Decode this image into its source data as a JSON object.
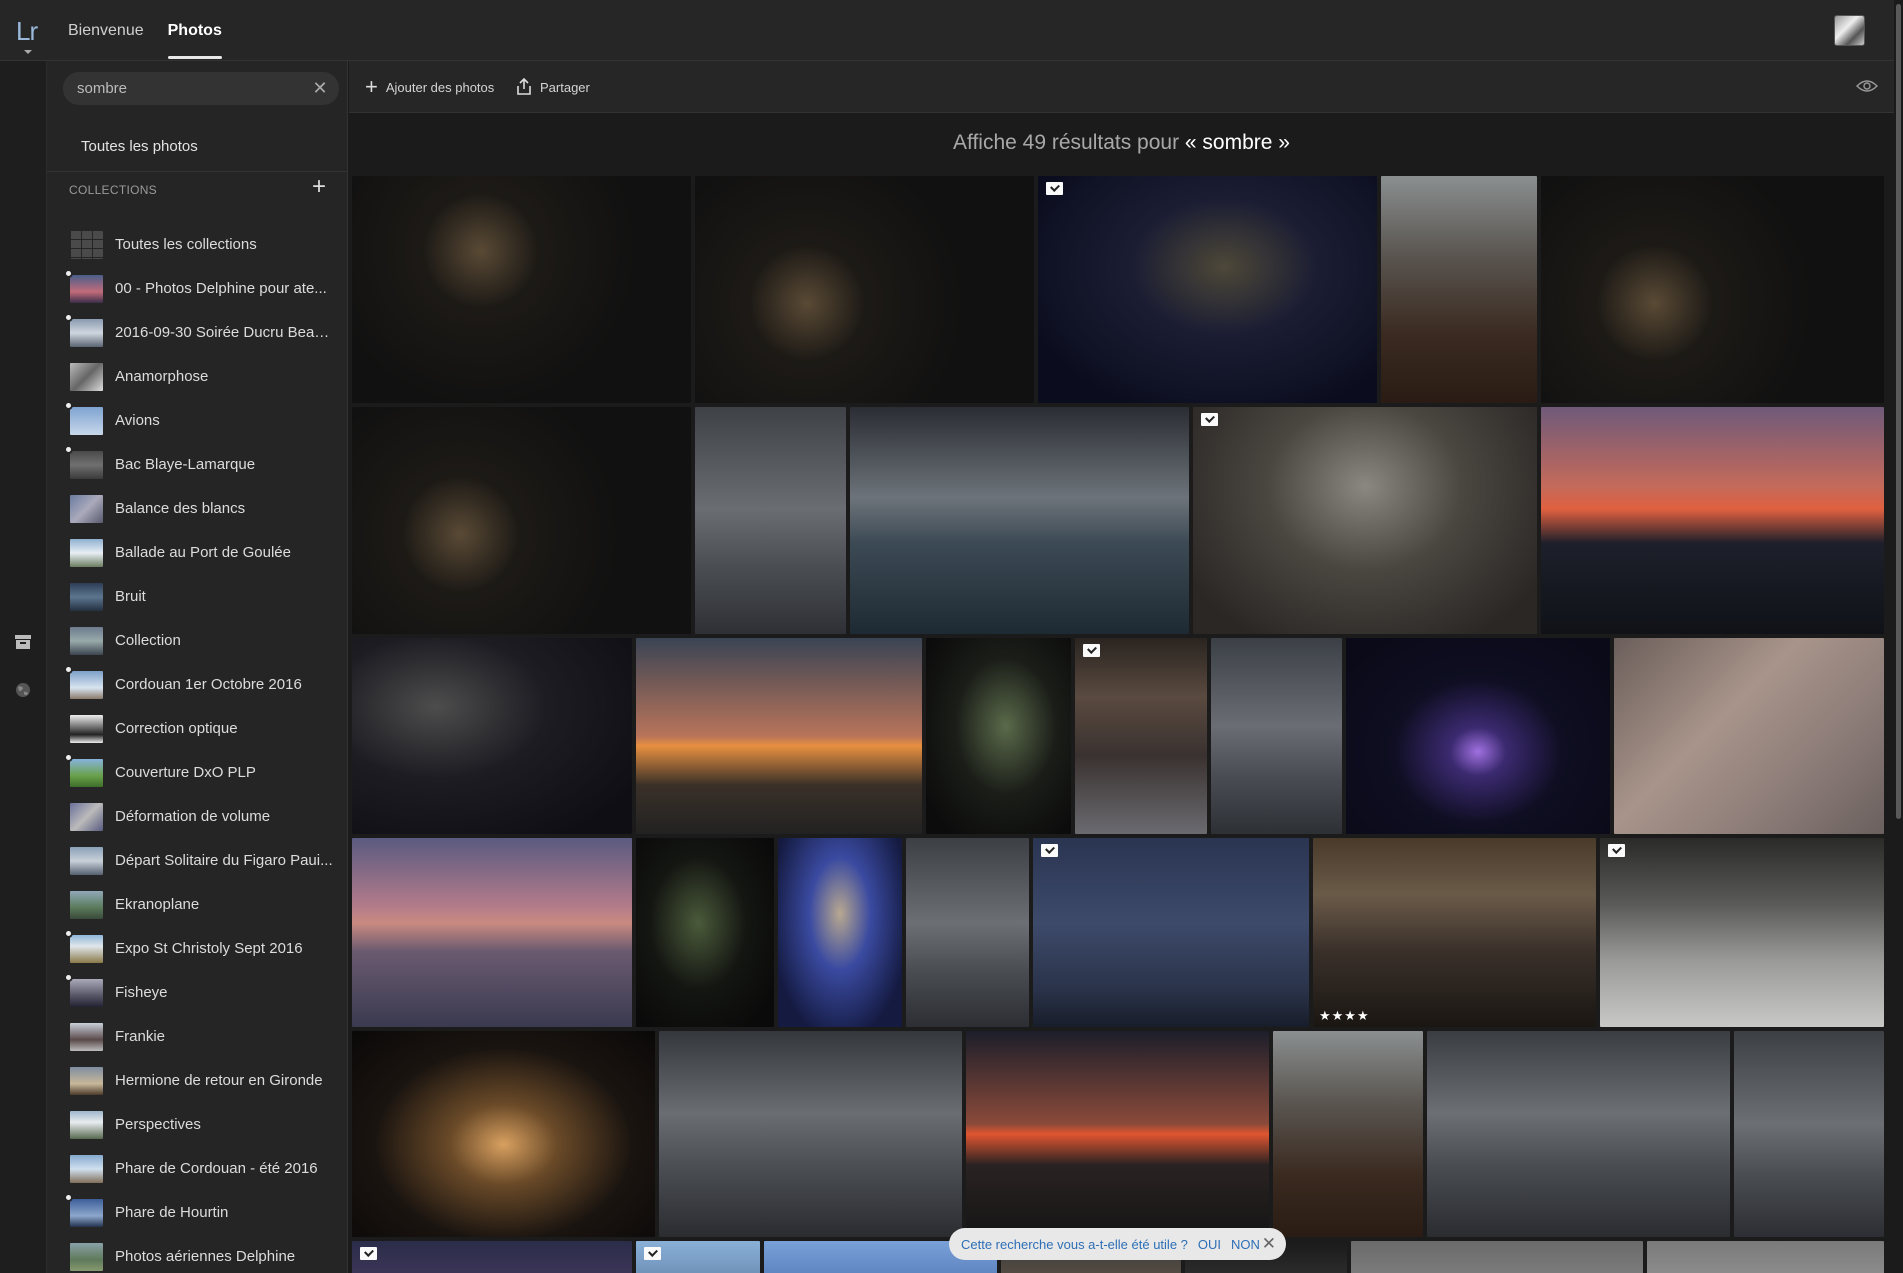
{
  "app": {
    "logo": "Lr",
    "nav": [
      {
        "label": "Bienvenue"
      },
      {
        "label": "Photos",
        "active": true
      }
    ]
  },
  "sidebar": {
    "search": {
      "value": "sombre"
    },
    "all_photos_label": "Toutes les photos",
    "collections_header": "COLLECTIONS",
    "collections": [
      {
        "label": "Toutes les collections",
        "shared": false
      },
      {
        "label": "00 - Photos Delphine pour ate...",
        "shared": true
      },
      {
        "label": "2016-09-30 Soirée Ducru Beau...",
        "shared": true
      },
      {
        "label": "Anamorphose",
        "shared": false
      },
      {
        "label": "Avions",
        "shared": true
      },
      {
        "label": "Bac Blaye-Lamarque",
        "shared": true
      },
      {
        "label": "Balance des blancs",
        "shared": false
      },
      {
        "label": "Ballade au Port de Goulée",
        "shared": false
      },
      {
        "label": "Bruit",
        "shared": false
      },
      {
        "label": "Collection",
        "shared": false
      },
      {
        "label": "Cordouan 1er Octobre 2016",
        "shared": true
      },
      {
        "label": "Correction optique",
        "shared": false
      },
      {
        "label": "Couverture DxO PLP",
        "shared": true
      },
      {
        "label": "Déformation de volume",
        "shared": false
      },
      {
        "label": "Départ Solitaire du Figaro Paui...",
        "shared": false
      },
      {
        "label": "Ekranoplane",
        "shared": false
      },
      {
        "label": "Expo St Christoly Sept 2016",
        "shared": true
      },
      {
        "label": "Fisheye",
        "shared": true
      },
      {
        "label": "Frankie",
        "shared": false
      },
      {
        "label": "Hermione de retour en Gironde",
        "shared": false
      },
      {
        "label": "Perspectives",
        "shared": false
      },
      {
        "label": "Phare de Cordouan - été 2016",
        "shared": false
      },
      {
        "label": "Phare de Hourtin",
        "shared": true
      },
      {
        "label": "Photos aériennes Delphine",
        "shared": false
      }
    ]
  },
  "toolbar": {
    "add_label": "Ajouter des photos",
    "share_label": "Partager"
  },
  "results": {
    "prefix": "Affiche 49 résultats pour",
    "query": "« sombre »"
  },
  "grid": {
    "tiles": [
      {
        "name": "photo-dark-room-1",
        "flag": false
      },
      {
        "name": "photo-dark-room-2",
        "flag": false
      },
      {
        "name": "photo-candles-dinner",
        "flag": true
      },
      {
        "name": "photo-lighthouse-stairs",
        "flag": false
      },
      {
        "name": "photo-dark-room-3",
        "flag": false
      },
      {
        "name": "photo-dark-room-4",
        "flag": false
      },
      {
        "name": "photo-cloudy-sky-1",
        "flag": false
      },
      {
        "name": "photo-stormy-sea",
        "flag": false
      },
      {
        "name": "photo-round-window",
        "flag": true
      },
      {
        "name": "photo-city-sunset",
        "flag": false
      },
      {
        "name": "photo-ekranoplane",
        "flag": false
      },
      {
        "name": "photo-lighthouse-lamp",
        "flag": false
      },
      {
        "name": "photo-night-garden-1",
        "flag": false
      },
      {
        "name": "photo-chapel-window",
        "flag": true
      },
      {
        "name": "photo-cloudy-sky-2",
        "flag": false
      },
      {
        "name": "photo-castle-purple",
        "flag": false
      },
      {
        "name": "photo-pool-palm",
        "flag": false
      },
      {
        "name": "photo-pink-sunset",
        "flag": false
      },
      {
        "name": "photo-night-garden-2",
        "flag": false
      },
      {
        "name": "photo-guitarist",
        "flag": false
      },
      {
        "name": "photo-cloudy-sky-3",
        "flag": false
      },
      {
        "name": "photo-lighthouse-dusk",
        "flag": true
      },
      {
        "name": "photo-hall-windows",
        "flag": false,
        "stars": "★★★★"
      },
      {
        "name": "photo-table-candles",
        "flag": true
      },
      {
        "name": "photo-birthday-child",
        "flag": false
      },
      {
        "name": "photo-cloudy-sky-4",
        "flag": false
      },
      {
        "name": "photo-silhouettes-sunset",
        "flag": false
      },
      {
        "name": "photo-lighthouse-stairs-2",
        "flag": false
      },
      {
        "name": "photo-cloudy-sky-5",
        "flag": false
      },
      {
        "name": "photo-cloudy-sky-6",
        "flag": false
      },
      {
        "name": "photo-row6-1",
        "flag": true
      },
      {
        "name": "photo-row6-2",
        "flag": true
      },
      {
        "name": "photo-row6-3",
        "flag": false
      },
      {
        "name": "photo-row6-4",
        "flag": false
      },
      {
        "name": "photo-row6-5",
        "flag": false
      },
      {
        "name": "photo-row6-6",
        "flag": false
      },
      {
        "name": "photo-row6-7",
        "flag": false
      }
    ]
  },
  "feedback": {
    "question": "Cette recherche vous a-t-elle été utile ?",
    "yes": "OUI",
    "no": "NON"
  }
}
